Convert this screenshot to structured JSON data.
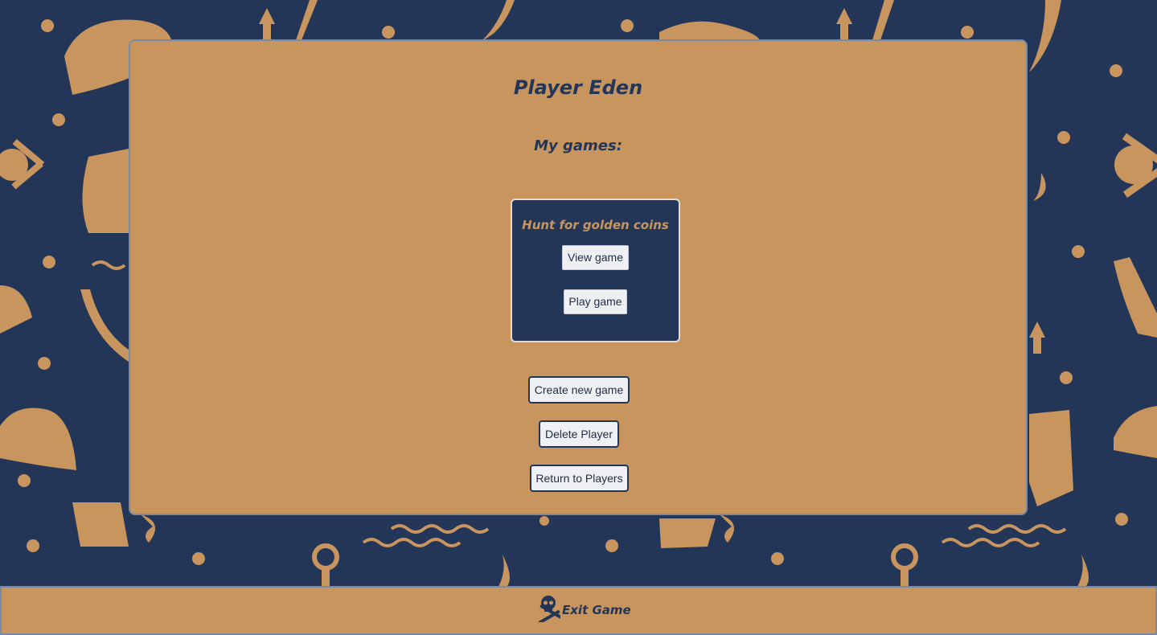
{
  "player": {
    "title": "Player Eden"
  },
  "games_section": {
    "heading": "My games:",
    "games": [
      {
        "title": "Hunt for golden coins",
        "view_label": "View game",
        "play_label": "Play game"
      }
    ]
  },
  "actions": {
    "create_label": "Create new game",
    "delete_label": "Delete Player",
    "return_label": "Return to Players"
  },
  "footer": {
    "exit_label": "Exit Game",
    "exit_icon": "skull-crossbones-icon"
  },
  "colors": {
    "navy": "#233657",
    "tan": "#c8955f",
    "button_bg": "#eef0f3"
  },
  "background": {
    "pattern_icons": [
      "pirate-hat-icon",
      "skull-icon",
      "anchor-icon",
      "pirate-ship-icon",
      "sword-icon",
      "bottle-icon",
      "hook-icon",
      "wave-icon",
      "coin-dot-icon"
    ]
  }
}
